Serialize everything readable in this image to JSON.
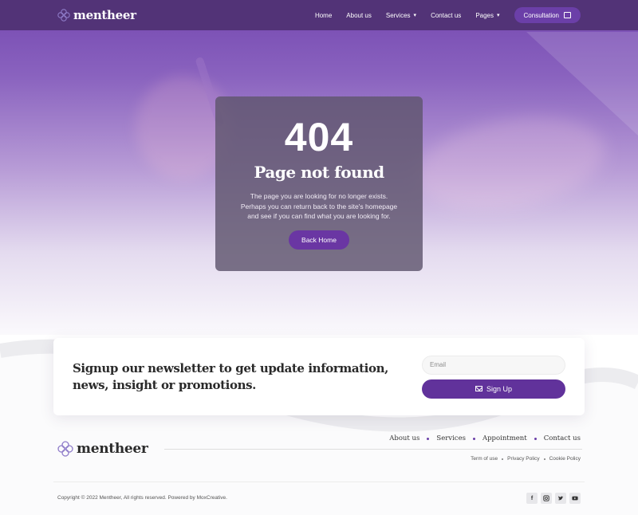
{
  "header": {
    "logo_text": "mentheer",
    "nav": [
      {
        "label": "Home"
      },
      {
        "label": "About us"
      },
      {
        "label": "Services"
      },
      {
        "label": "Contact us"
      },
      {
        "label": "Pages"
      }
    ],
    "cta_label": "Consultation"
  },
  "error": {
    "code": "404",
    "title": "Page not found",
    "line1": "The page you are looking for no longer exists.",
    "line2": "Perhaps you can return back to the site's homepage",
    "line3": "and see if you can find what you are looking for.",
    "button_label": "Back Home"
  },
  "newsletter": {
    "heading": "Signup our newsletter to get update information, news, insight or promotions.",
    "email_placeholder": "Email",
    "button_label": "Sign Up"
  },
  "footer": {
    "logo_text": "mentheer",
    "nav": [
      "About us",
      "Services",
      "Appointment",
      "Contact us"
    ],
    "legal": [
      "Term of use",
      "Privacy Policy",
      "Cookie Policy"
    ],
    "copyright": "Copyright © 2022 Mentheer, All rights reserved. Powered by MoxCreative.",
    "social_icons": [
      "facebook-icon",
      "instagram-icon",
      "twitter-icon",
      "youtube-icon"
    ]
  },
  "colors": {
    "brand_purple": "#61329b",
    "header_bg": "#523377"
  }
}
